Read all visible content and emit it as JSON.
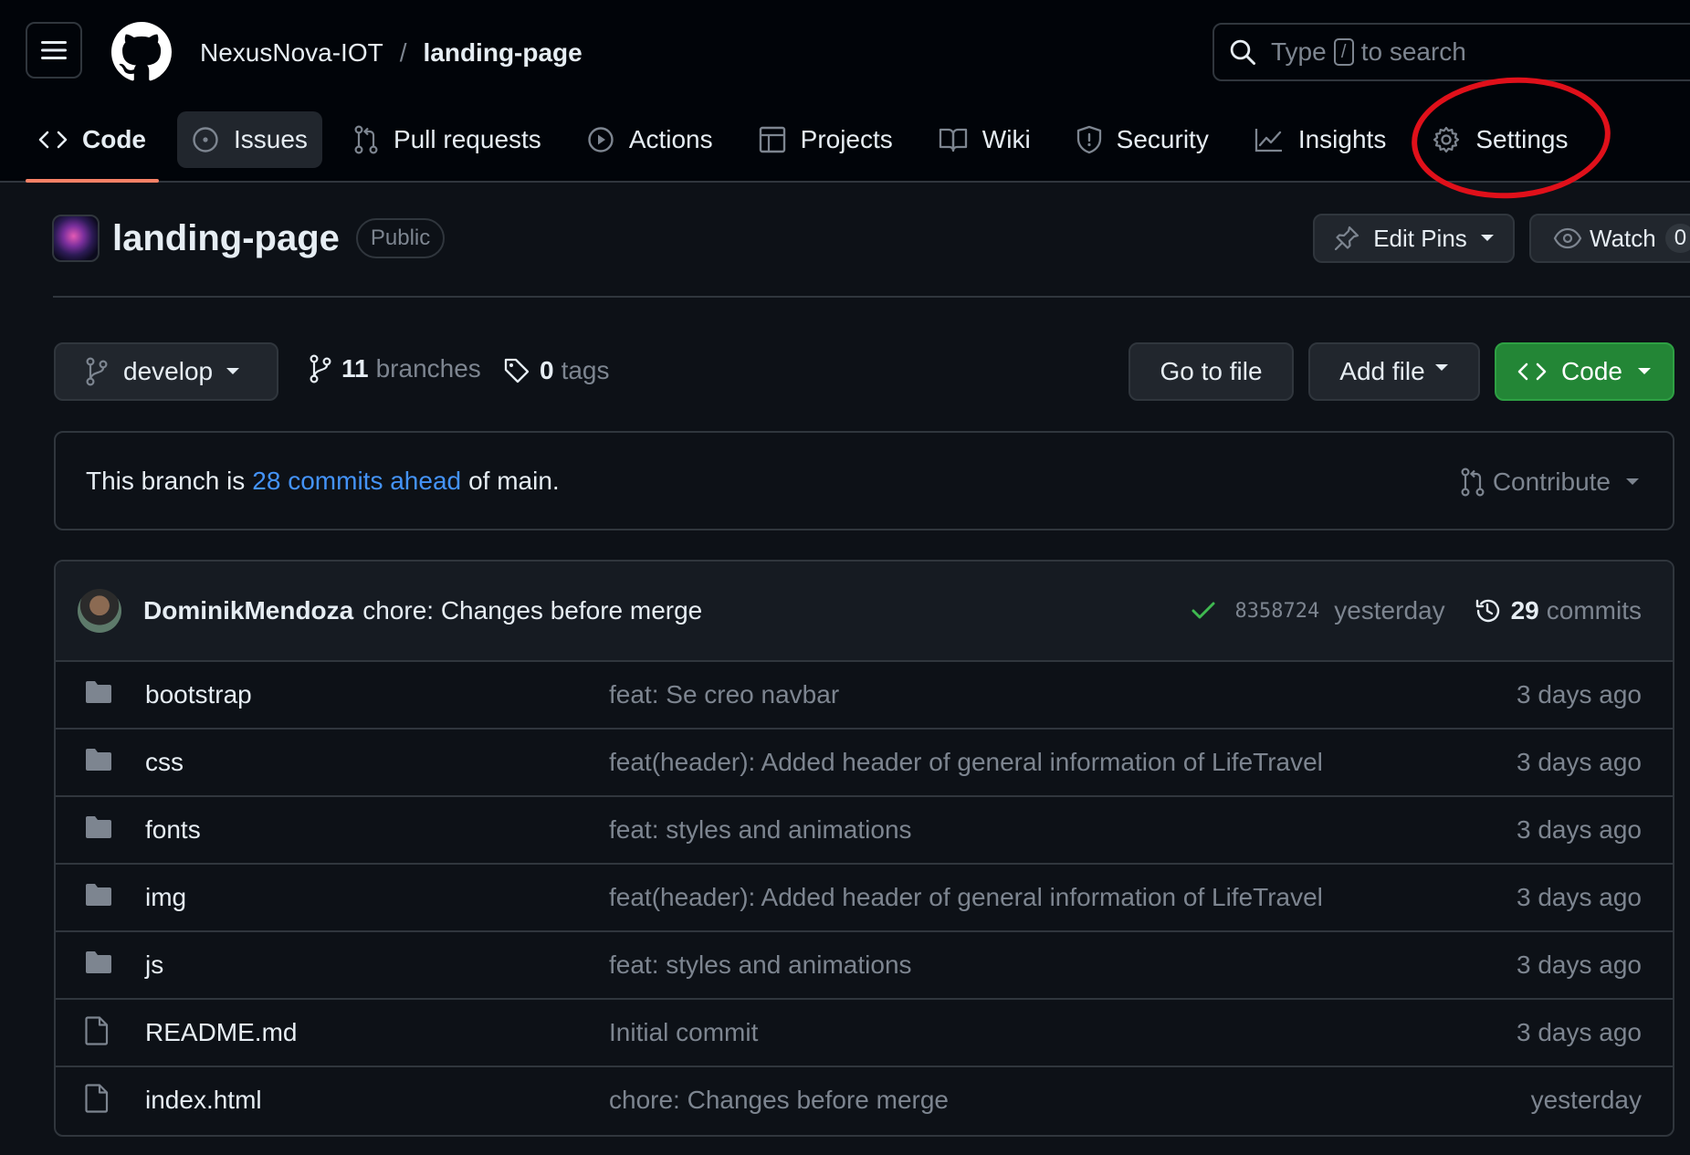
{
  "header": {
    "owner": "NexusNova-IOT",
    "separator": "/",
    "repo": "landing-page",
    "search": {
      "prefix": "Type",
      "key": "/",
      "suffix": "to search"
    }
  },
  "nav": {
    "tabs": [
      {
        "id": "code",
        "label": "Code",
        "icon": "code-icon",
        "active": true
      },
      {
        "id": "issues",
        "label": "Issues",
        "icon": "issue-opened-icon"
      },
      {
        "id": "pulls",
        "label": "Pull requests",
        "icon": "git-pull-request-icon"
      },
      {
        "id": "actions",
        "label": "Actions",
        "icon": "play-icon"
      },
      {
        "id": "projects",
        "label": "Projects",
        "icon": "table-icon"
      },
      {
        "id": "wiki",
        "label": "Wiki",
        "icon": "book-icon"
      },
      {
        "id": "security",
        "label": "Security",
        "icon": "shield-icon"
      },
      {
        "id": "insights",
        "label": "Insights",
        "icon": "graph-icon"
      },
      {
        "id": "settings",
        "label": "Settings",
        "icon": "gear-icon"
      }
    ],
    "annotation_color": "#e0101a"
  },
  "repo": {
    "name": "landing-page",
    "visibility": "Public",
    "edit_pins_label": "Edit Pins",
    "watch_label": "Watch",
    "watch_count": "0"
  },
  "branch_bar": {
    "branch": "develop",
    "branches_count": "11",
    "branches_label": "branches",
    "tags_count": "0",
    "tags_label": "tags",
    "go_to_file": "Go to file",
    "add_file": "Add file",
    "code_button": "Code"
  },
  "ahead": {
    "prefix": "This branch is",
    "link": "28 commits ahead",
    "suffix": "of main.",
    "contribute": "Contribute"
  },
  "latest_commit": {
    "author": "DominikMendoza",
    "message": "chore: Changes before merge",
    "sha": "8358724",
    "time": "yesterday",
    "commits_count": "29",
    "commits_label": "commits"
  },
  "files": [
    {
      "name": "bootstrap",
      "type": "dir",
      "message": "feat: Se creo navbar",
      "age": "3 days ago"
    },
    {
      "name": "css",
      "type": "dir",
      "message": "feat(header): Added header of general information of LifeTravel",
      "age": "3 days ago"
    },
    {
      "name": "fonts",
      "type": "dir",
      "message": "feat: styles and animations",
      "age": "3 days ago"
    },
    {
      "name": "img",
      "type": "dir",
      "message": "feat(header): Added header of general information of LifeTravel",
      "age": "3 days ago"
    },
    {
      "name": "js",
      "type": "dir",
      "message": "feat: styles and animations",
      "age": "3 days ago"
    },
    {
      "name": "README.md",
      "type": "file",
      "message": "Initial commit",
      "age": "3 days ago"
    },
    {
      "name": "index.html",
      "type": "file",
      "message": "chore: Changes before merge",
      "age": "yesterday"
    }
  ],
  "colors": {
    "background": "#0d1117",
    "header_bg": "#010409",
    "border": "#30363d",
    "link": "#4493f8",
    "green": "#238636",
    "active_underline": "#f78166"
  }
}
